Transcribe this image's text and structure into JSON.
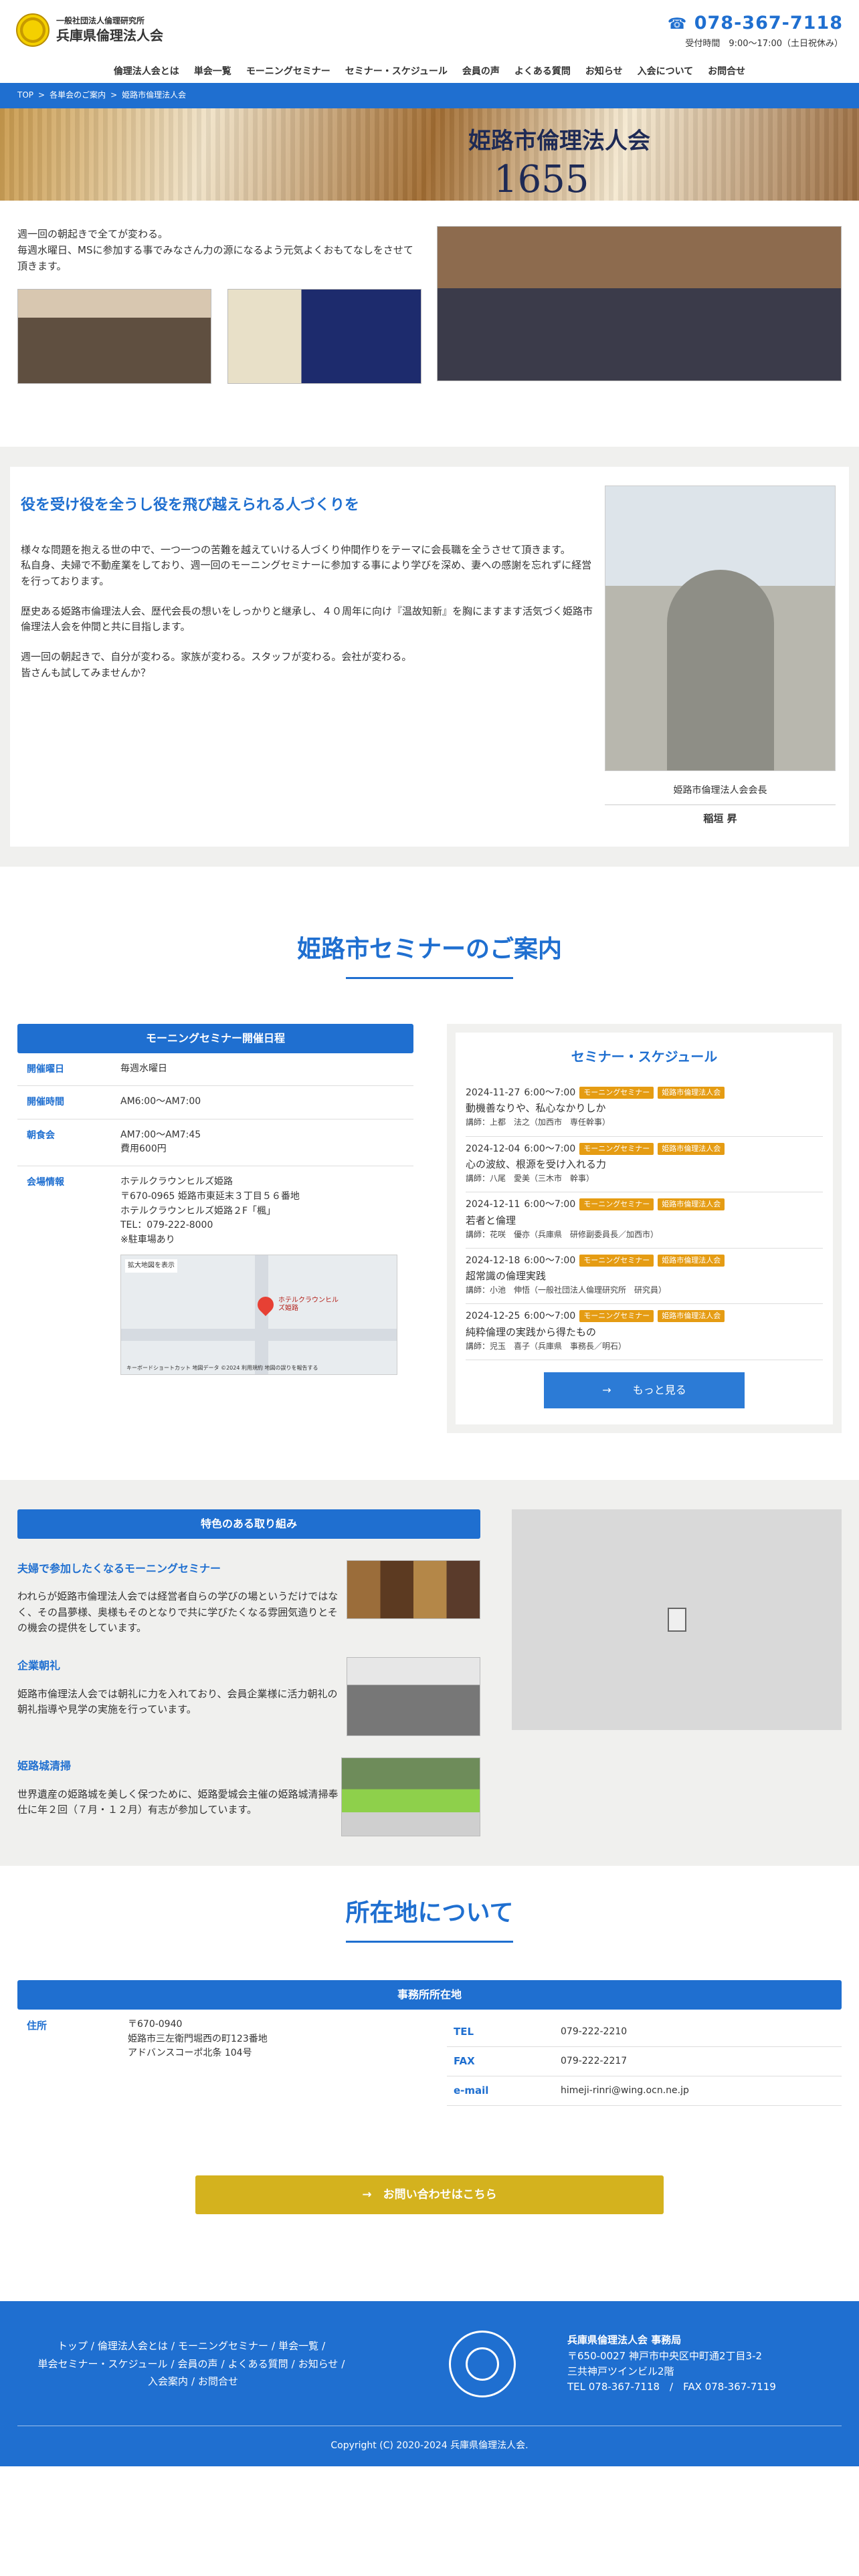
{
  "header": {
    "org_small": "一般社団法人倫理研究所",
    "org_big": "兵庫県倫理法人会",
    "tel": "078-367-7118",
    "hours": "受付時間　9:00～17:00（土日祝休み）"
  },
  "nav": [
    "倫理法人会とは",
    "単会一覧",
    "モーニングセミナー",
    "セミナー・スケジュール",
    "会員の声",
    "よくある質問",
    "お知らせ",
    "入会について",
    "お問合せ"
  ],
  "breadcrumb": [
    "TOP",
    "各単会のご案内",
    "姫路市倫理法人会"
  ],
  "hero": {
    "text": "姫路市倫理法人会",
    "number": "1655"
  },
  "intro": {
    "line1": "週一回の朝起きで全てが変わる。",
    "line2": "毎週水曜日、MSに参加する事でみなさん力の源になるよう元気よくおもてなしをさせて頂きます。"
  },
  "message": {
    "title": "役を受け役を全うし役を飛び越えられる人づくりを",
    "p1": "様々な問題を抱える世の中で、一つ一つの苦難を越えていける人づくり仲間作りをテーマに会長職を全うさせて頂きます。\n私自身、夫婦で不動産業をしており、週一回のモーニングセミナーに参加する事により学びを深め、妻への感謝を忘れずに経営を行っております。",
    "p2": "歴史ある姫路市倫理法人会、歴代会長の想いをしっかりと継承し、４０周年に向け『温故知新』を胸にますます活気づく姫路市倫理法人会を仲間と共に目指します。",
    "p3": "週一回の朝起きで、自分が変わる。家族が変わる。スタッフが変わる。会社が変わる。\n皆さんも試してみませんか？",
    "caption_role": "姫路市倫理法人会会長",
    "caption_name": "稲垣 昇"
  },
  "seminar_section": {
    "title": "姫路市セミナーのご案内"
  },
  "schedule_info": {
    "title": "モーニングセミナー開催日程",
    "rows": [
      {
        "label": "開催曜日",
        "value": "毎週水曜日"
      },
      {
        "label": "開催時間",
        "value": "AM6:00〜AM7:00"
      },
      {
        "label": "朝食会",
        "value": "AM7:00〜AM7:45\n費用600円"
      },
      {
        "label": "会場情報",
        "value": "ホテルクラウンヒルズ姫路\n〒670-0965 姫路市東延末３丁目５６番地\nホテルクラウンヒルズ姫路２F「楓」\nTEL：079-222-8000\n※駐車場あり"
      }
    ],
    "map_labels": [
      "拡大地図を表示",
      "ホテルクラウンヒルズ姫路",
      "キーボードショートカット",
      "地図データ ©2024",
      "利用規約",
      "地図の誤りを報告する"
    ]
  },
  "seminar_schedule": {
    "title": "セミナー・スケジュール",
    "tag1": "モーニングセミナー",
    "tag2": "姫路市倫理法人会",
    "items": [
      {
        "date": "2024-11-27",
        "time": "6:00～7:00",
        "topic": "動機善なりや、私心なかりしか",
        "lecturer": "講師：上都　法之（加西市　専任幹事）"
      },
      {
        "date": "2024-12-04",
        "time": "6:00～7:00",
        "topic": "心の波紋、根源を受け入れる力",
        "lecturer": "講師：八尾　愛美（三木市　幹事）"
      },
      {
        "date": "2024-12-11",
        "time": "6:00～7:00",
        "topic": "若者と倫理",
        "lecturer": "講師：花咲　優亦（兵庫県　研修副委員長／加西市）"
      },
      {
        "date": "2024-12-18",
        "time": "6:00～7:00",
        "topic": "超常識の倫理実践",
        "lecturer": "講師：小池　伸悟（一般社団法人倫理研究所　研究員）"
      },
      {
        "date": "2024-12-25",
        "time": "6:00～7:00",
        "topic": "純粋倫理の実践から得たもの",
        "lecturer": "講師：児玉　喜子（兵庫県　事務長／明石）"
      }
    ],
    "more": "→　　もっと見る"
  },
  "features": {
    "title": "特色のある取り組み",
    "items": [
      {
        "title": "夫婦で参加したくなるモーニングセミナー",
        "text": "われらが姫路市倫理法人会では経営者自らの学びの場というだけではなく、その昌夢様、奥様もそのとなりで共に学びたくなる雰囲気造りとその機会の提供をしています。"
      },
      {
        "title": "企業朝礼",
        "text": "姫路市倫理法人会では朝礼に力を入れており、会員企業様に活力朝礼の朝礼指導や見学の実施を行っています。"
      },
      {
        "title": "姫路城清掃",
        "text": "世界遺産の姫路城を美しく保つために、姫路愛城会主催の姫路城清掃奉仕に年２回（７月・１２月）有志が参加しています。"
      }
    ]
  },
  "location": {
    "title": "所在地について",
    "bar": "事務所所在地",
    "address_label": "住所",
    "address": "〒670-0940\n姫路市三左衛門堀西の町123番地\nアドバンスコーポ北条 104号",
    "contacts": [
      {
        "label": "TEL",
        "value": "079-222-2210"
      },
      {
        "label": "FAX",
        "value": "079-222-2217"
      },
      {
        "label": "e-mail",
        "value": "himeji-rinri@wing.ocn.ne.jp"
      }
    ]
  },
  "cta": "→　お問い合わせはこちら",
  "footer": {
    "links_row1": [
      "トップ",
      "倫理法人会とは",
      "モーニングセミナー",
      "単会一覧"
    ],
    "links_row2": [
      "単会セミナー・スケジュール",
      "会員の声",
      "よくある質問",
      "お知らせ"
    ],
    "links_row3": [
      "入会案内",
      "お問合せ"
    ],
    "office_name": "兵庫県倫理法人会 事務局",
    "office_address": "〒650-0027 神戸市中央区中町通2丁目3-2\n三共神戸ツインビル2階",
    "office_tel": "TEL 078-367-7118　/　FAX 078-367-7119",
    "copyright": "Copyright (C) 2020-2024 兵庫県倫理法人会."
  }
}
